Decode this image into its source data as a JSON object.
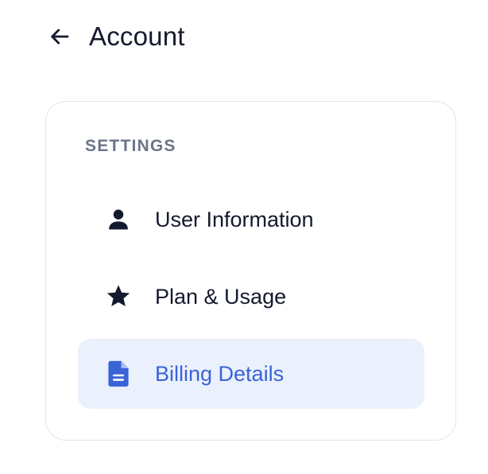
{
  "header": {
    "back_icon": "arrow-left-icon",
    "title": "Account"
  },
  "settings": {
    "section_label": "SETTINGS",
    "items": [
      {
        "label": "User Information",
        "icon": "user-icon",
        "active": false
      },
      {
        "label": "Plan & Usage",
        "icon": "star-icon",
        "active": false
      },
      {
        "label": "Billing Details",
        "icon": "document-icon",
        "active": true
      }
    ]
  },
  "colors": {
    "text": "#141a2e",
    "muted": "#6b7488",
    "accent": "#3b63d8",
    "active_bg": "#eaf0fc",
    "border": "#e3e5ea"
  }
}
